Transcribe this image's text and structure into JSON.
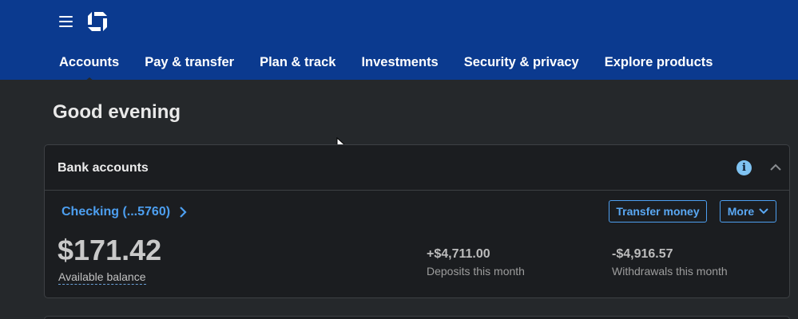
{
  "header": {
    "menu_icon": "hamburger-menu-icon",
    "logo_icon": "chase-octagon-logo",
    "nav": [
      {
        "label": "Accounts",
        "active": true
      },
      {
        "label": "Pay & transfer"
      },
      {
        "label": "Plan & track"
      },
      {
        "label": "Investments"
      },
      {
        "label": "Security & privacy"
      },
      {
        "label": "Explore products"
      }
    ]
  },
  "greeting": "Good evening",
  "bank_accounts": {
    "title": "Bank accounts",
    "info_icon": "info-icon",
    "collapse_icon": "chevron-up-icon",
    "account": {
      "name": "Checking (...5760)",
      "transfer_button": "Transfer money",
      "more_button": "More",
      "balance": "$171.42",
      "balance_label": "Available balance",
      "deposits_value": "+$4,711.00",
      "deposits_label": "Deposits this month",
      "withdrawals_value": "-$4,916.57",
      "withdrawals_label": "Withdrawals this month"
    }
  },
  "colors": {
    "header_bg": "#0b3a8f",
    "page_bg": "#25282b",
    "card_bg": "#1b1d20",
    "link": "#4d9ff0"
  }
}
